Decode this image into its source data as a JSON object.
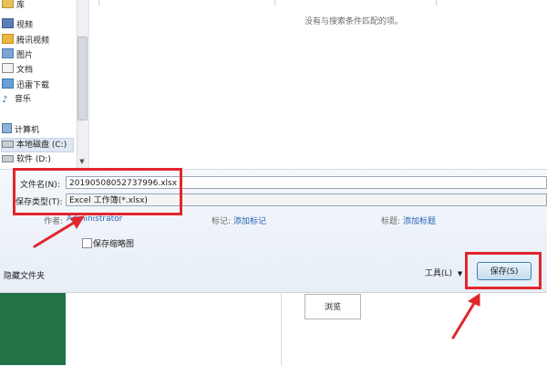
{
  "nav": {
    "items": [
      {
        "label": "库",
        "icon": "library-icon"
      },
      {
        "label": "视频",
        "icon": "video-icon"
      },
      {
        "label": "腾讯视频",
        "icon": "video-app-icon"
      },
      {
        "label": "图片",
        "icon": "picture-icon"
      },
      {
        "label": "文档",
        "icon": "document-icon"
      },
      {
        "label": "迅雷下载",
        "icon": "download-icon"
      },
      {
        "label": "音乐",
        "icon": "music-icon"
      },
      {
        "label": "计算机",
        "icon": "computer-icon"
      },
      {
        "label": "本地磁盘 (C:)",
        "icon": "drive-icon"
      },
      {
        "label": "软件 (D:)",
        "icon": "drive-icon"
      }
    ]
  },
  "file_list": {
    "empty_message": "没有与搜索条件匹配的项。"
  },
  "form": {
    "filename_label": "文件名(N):",
    "filename_value": "20190508052737996.xlsx",
    "filetype_label": "保存类型(T):",
    "filetype_value": "Excel 工作簿(*.xlsx)",
    "author_label": "作者:",
    "author_value": "Administrator",
    "tags_label": "标记:",
    "tags_value": "添加标记",
    "title_label": "标题:",
    "title_value": "添加标题",
    "thumbnail_label": "保存缩略图"
  },
  "footer": {
    "hide_folders": "隐藏文件夹",
    "tools_label": "工具(L)",
    "save_label": "保存(S)"
  },
  "background_app": {
    "browse_label": "浏览"
  },
  "colors": {
    "annotation": "#e1262d",
    "excel_green": "#217346",
    "link": "#2a62b5"
  }
}
